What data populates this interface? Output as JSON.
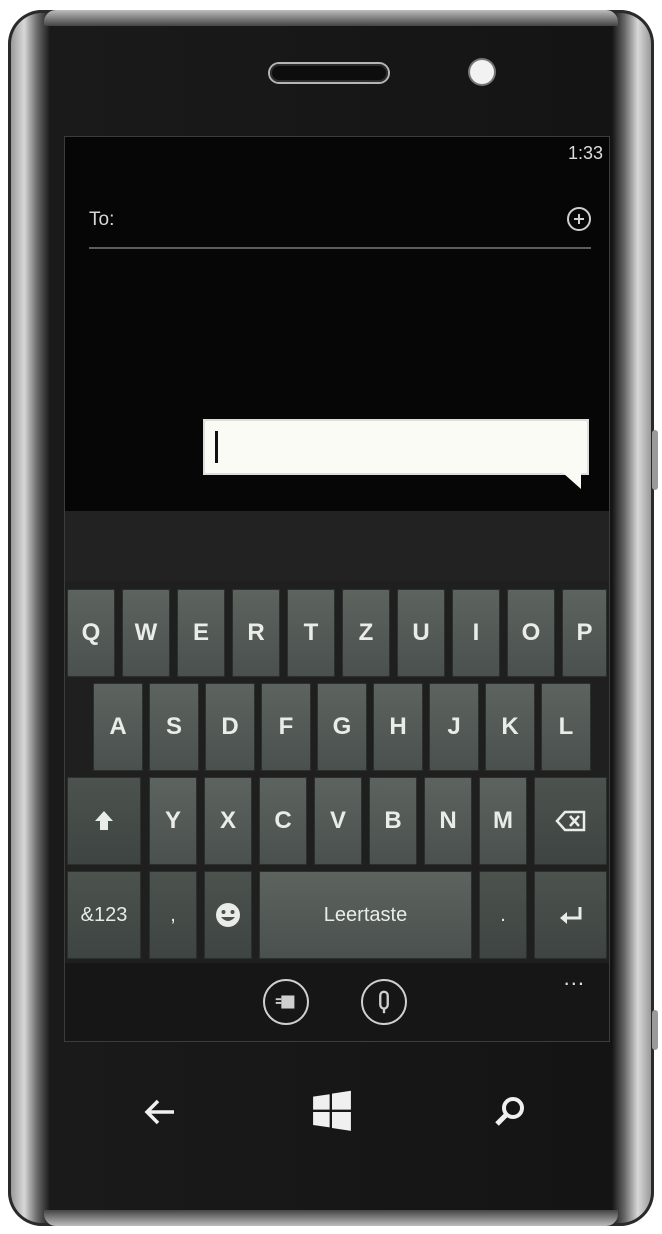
{
  "status_bar": {
    "time": "1:33"
  },
  "compose": {
    "to_label": "To:",
    "message_value": ""
  },
  "keyboard": {
    "row1": [
      "Q",
      "W",
      "E",
      "R",
      "T",
      "Z",
      "U",
      "I",
      "O",
      "P"
    ],
    "row2": [
      "A",
      "S",
      "D",
      "F",
      "G",
      "H",
      "J",
      "K",
      "L"
    ],
    "row3": [
      "Y",
      "X",
      "C",
      "V",
      "B",
      "N",
      "M"
    ],
    "symbols_label": "&123",
    "comma_label": ",",
    "space_label": "Leertaste",
    "period_label": ".",
    "more_label": "..."
  },
  "icons": {
    "add_contact": "add-contact-icon",
    "shift": "shift-icon",
    "backspace": "backspace-icon",
    "emoji": "emoji-icon",
    "enter": "enter-icon",
    "input_language": "keyboard-language-icon",
    "microphone": "microphone-icon",
    "back": "back-arrow-icon",
    "start": "windows-logo-icon",
    "search": "search-icon"
  }
}
